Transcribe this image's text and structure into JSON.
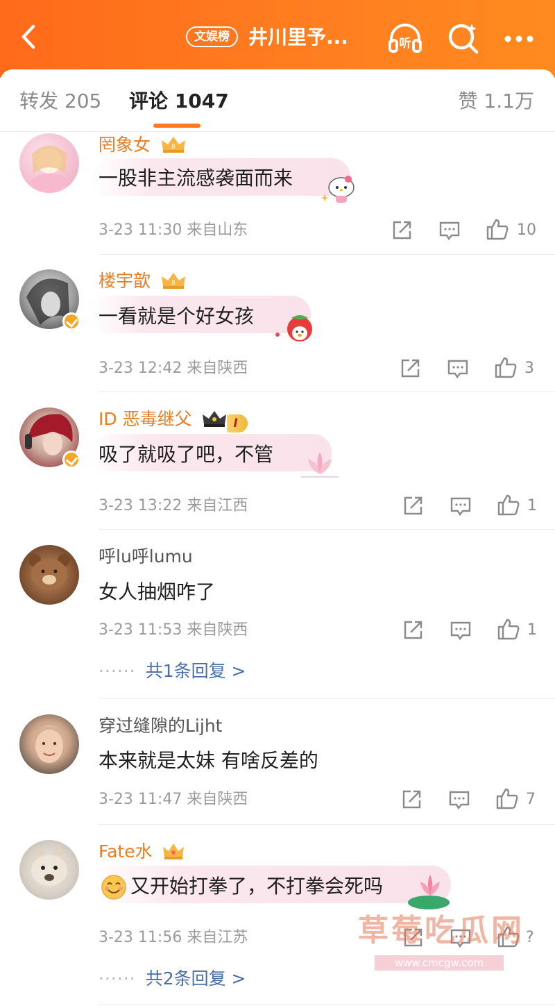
{
  "header": {
    "tag": "文娱榜",
    "title": "井川里予..."
  },
  "tabs": [
    {
      "label": "转发 205"
    },
    {
      "label": "评论 1047"
    },
    {
      "label": "赞 1.1万"
    }
  ],
  "comments": [
    {
      "user": "罔象女",
      "text": "一股非主流感袭面而来",
      "time": "3-23 11:30",
      "location": "来自山东",
      "likes": "10"
    },
    {
      "user": "楼宇歆",
      "text": "一看就是个好女孩",
      "time": "3-23 12:42",
      "location": "来自陕西",
      "likes": "3"
    },
    {
      "user": "ID 恶毒继父",
      "badge": "I",
      "text": "吸了就吸了吧，不管",
      "time": "3-23 13:22",
      "location": "来自江西",
      "likes": "1"
    },
    {
      "user": "呼lu呼lumu",
      "text": "女人抽烟咋了",
      "time": "3-23 11:53",
      "location": "来自陕西",
      "likes": "1",
      "replies": "共1条回复 >"
    },
    {
      "user": "穿过缝隙的Lijht",
      "text": "本来就是太妹  有啥反差的",
      "time": "3-23 11:47",
      "location": "来自陕西",
      "likes": "7"
    },
    {
      "user": "Fate水",
      "text": "又开始打拳了，不打拳会死吗",
      "time": "3-23 11:56",
      "location": "来自江苏",
      "likes": "?",
      "replies": "共2条回复 >"
    }
  ],
  "watermark": {
    "text": "草莓吃瓜网",
    "url": "www.cmcgw.com"
  },
  "colors": {
    "accent": "#ff7a1f",
    "vip_name": "#e87d24",
    "reply_link": "#4a6ea8",
    "meta": "#9a9a9a"
  },
  "icons": {
    "back": "chevron-left-icon",
    "listen": "headphones-icon",
    "search": "search-icon",
    "more": "more-icon",
    "share": "share-icon",
    "comment": "comment-icon",
    "like": "thumbs-up-icon"
  }
}
